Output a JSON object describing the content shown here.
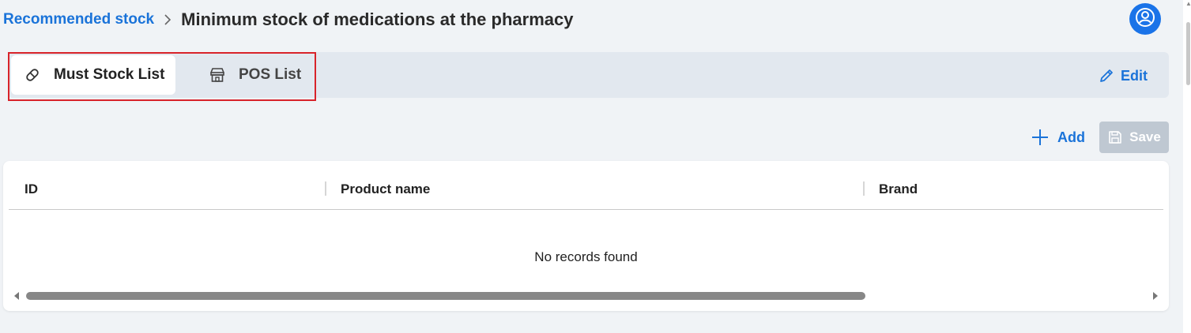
{
  "breadcrumb": {
    "link_label": "Recommended stock",
    "title": "Minimum stock of medications at the pharmacy"
  },
  "tabs": [
    {
      "label": "Must Stock List",
      "icon": "pill-icon",
      "active": true
    },
    {
      "label": "POS List",
      "icon": "store-icon",
      "active": false
    }
  ],
  "toolbar": {
    "edit_label": "Edit",
    "add_label": "Add",
    "save_label": "Save"
  },
  "table": {
    "columns": [
      "ID",
      "Product name",
      "Brand"
    ],
    "empty_message": "No records found"
  },
  "colors": {
    "accent": "#1a73d9",
    "highlight": "#d8232a",
    "save_disabled": "#bfc8d2"
  }
}
